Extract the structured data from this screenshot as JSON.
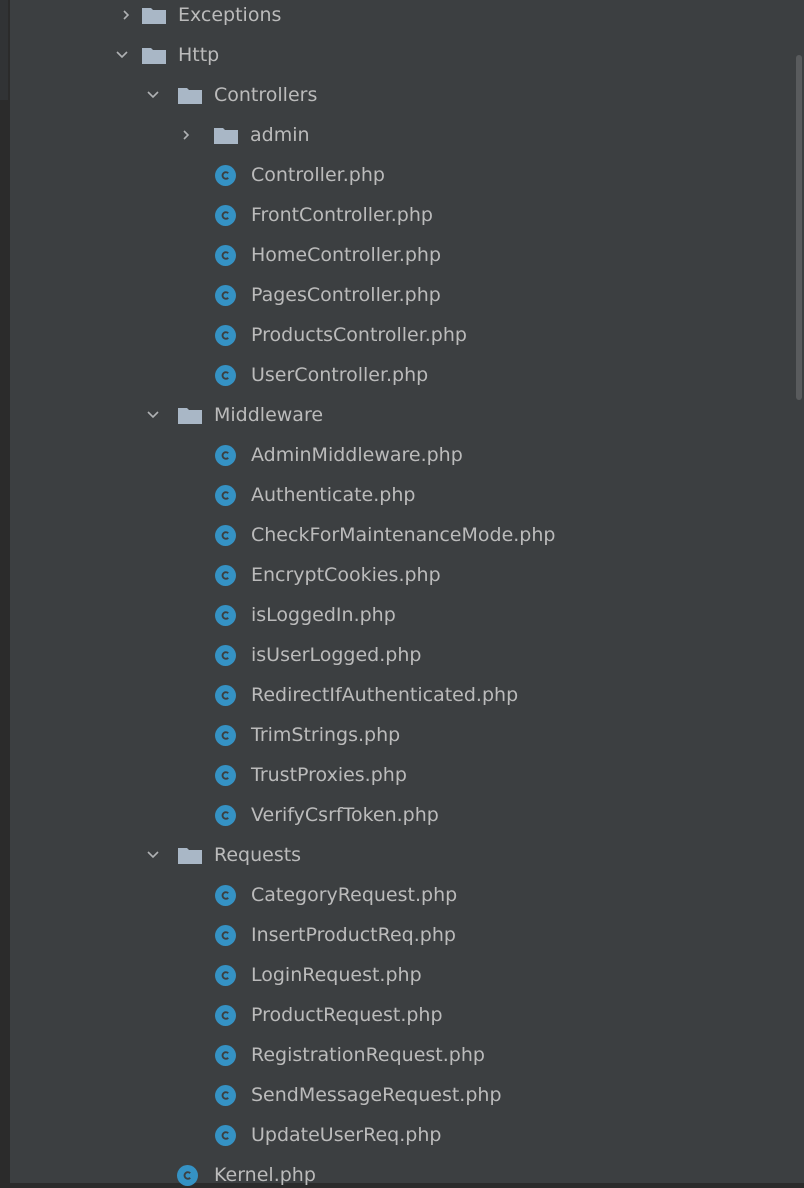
{
  "tree": {
    "exceptions": {
      "label": "Exceptions"
    },
    "http": {
      "label": "Http"
    },
    "controllers": {
      "label": "Controllers",
      "admin": "admin",
      "files": [
        "Controller.php",
        "FrontController.php",
        "HomeController.php",
        "PagesController.php",
        "ProductsController.php",
        "UserController.php"
      ]
    },
    "middleware": {
      "label": "Middleware",
      "files": [
        "AdminMiddleware.php",
        "Authenticate.php",
        "CheckForMaintenanceMode.php",
        "EncryptCookies.php",
        "isLoggedIn.php",
        "isUserLogged.php",
        "RedirectIfAuthenticated.php",
        "TrimStrings.php",
        "TrustProxies.php",
        "VerifyCsrfToken.php"
      ]
    },
    "requests": {
      "label": "Requests",
      "files": [
        "CategoryRequest.php",
        "InsertProductReq.php",
        "LoginRequest.php",
        "ProductRequest.php",
        "RegistrationRequest.php",
        "SendMessageRequest.php",
        "UpdateUserReq.php"
      ]
    },
    "kernel": {
      "label": "Kernel.php"
    }
  },
  "colors": {
    "background": "#3c3f41",
    "text": "#bbbbbb",
    "folder": "#a9b7c6",
    "class_badge": "#3592c4",
    "scrollbar": "#595b5d"
  },
  "icons": {
    "folder": "folder-icon",
    "class": "php-class-icon",
    "expanded": "chevron-down-icon",
    "collapsed": "chevron-right-icon"
  }
}
